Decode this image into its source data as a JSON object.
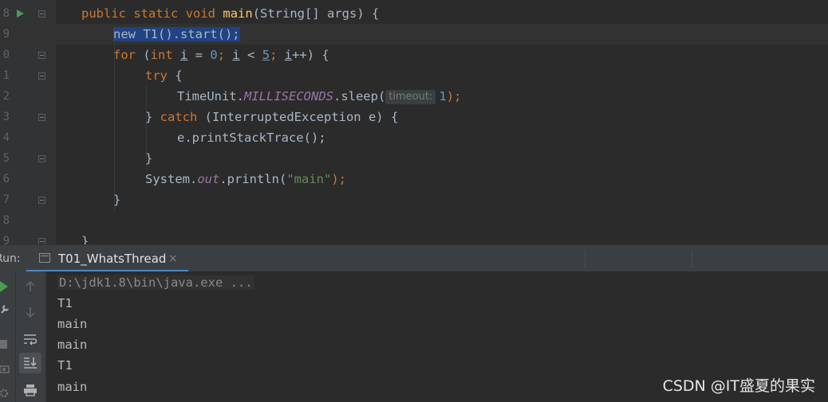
{
  "editor": {
    "line_numbers": [
      "8",
      "9",
      "0",
      "1",
      "2",
      "3",
      "4",
      "5",
      "6",
      "7",
      "8",
      "9"
    ],
    "line8": {
      "kw1": "public",
      "kw2": "static",
      "kw3": "void",
      "method": "main",
      "rest": "(String[] args) {"
    },
    "line9": {
      "code": "new T1().start();"
    },
    "line10": {
      "kw": "for",
      "open": " (",
      "type": "int",
      "sp": " ",
      "i1": "i",
      "eq": " = ",
      "zero": "0",
      "semi1": "; ",
      "i2": "i",
      "lt": " < ",
      "five": "5",
      "semi2": "; ",
      "i3": "i",
      "inc": "++) {"
    },
    "line11": {
      "kw": "try",
      "rest": " {"
    },
    "line12": {
      "cls": "TimeUnit.",
      "field": "MILLISECONDS",
      "call": ".sleep(",
      "hint": "timeout:",
      "arg": "1",
      "end": ");"
    },
    "line13": {
      "close": "} ",
      "kw": "catch",
      "rest": " (InterruptedException e) {"
    },
    "line14": {
      "code": "e.printStackTrace();"
    },
    "line15": {
      "code": "}"
    },
    "line16": {
      "cls": "System.",
      "field": "out",
      "call": ".println(",
      "str": "\"main\"",
      "end": ");"
    },
    "line17": {
      "code": "}"
    },
    "line19": {
      "code": "}"
    }
  },
  "run_panel": {
    "label": "Run:",
    "tab_label": "T01_WhatsThread",
    "tab_close": "×"
  },
  "console": {
    "command": "D:\\jdk1.8\\bin\\java.exe ...",
    "lines": [
      "T1",
      "main",
      "main",
      "T1",
      "main"
    ]
  },
  "watermark": "CSDN @IT盛夏的果实",
  "colors": {
    "keyword": "#cc7832",
    "method": "#ffc66d",
    "number": "#6897bb",
    "string": "#6a8759",
    "static_field": "#9876aa",
    "selection": "#214283",
    "tab_underline": "#4a88c7",
    "run_icon": "#499c54"
  }
}
